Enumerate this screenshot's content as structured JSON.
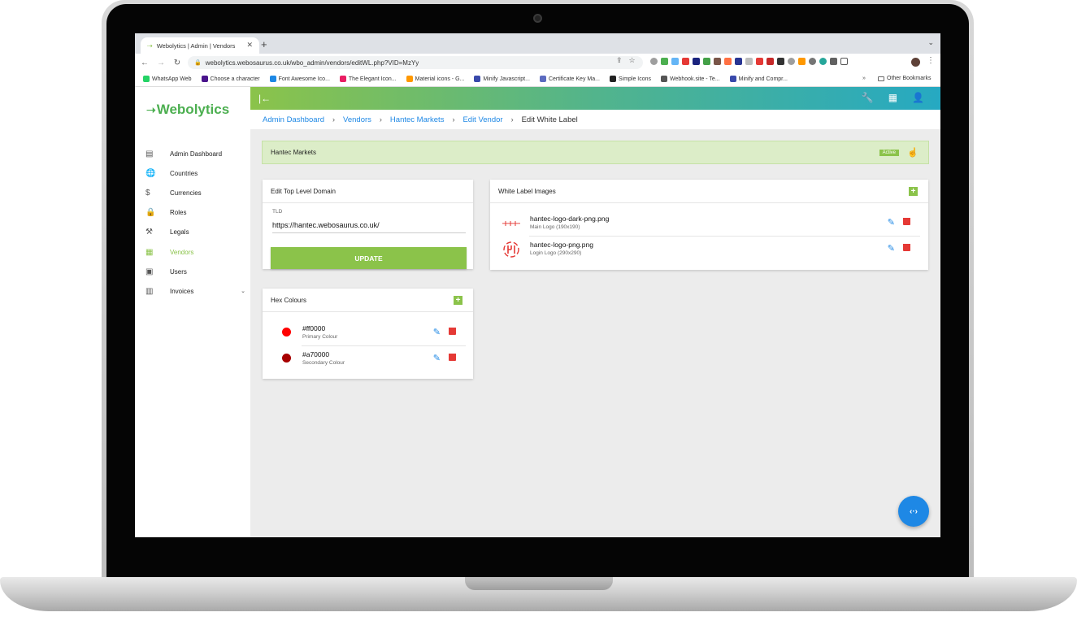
{
  "browser": {
    "tab_title": "Webolytics | Admin | Vendors",
    "url": "webolytics.webosaurus.co.uk/wbo_admin/vendors/editWL.php?VID=MzYy",
    "bookmarks": [
      {
        "label": "WhatsApp Web",
        "color": "#25d366"
      },
      {
        "label": "Choose a character",
        "color": "#4a148c"
      },
      {
        "label": "Font Awesome Ico...",
        "color": "#1e88e5"
      },
      {
        "label": "The Elegant Icon...",
        "color": "#e91e63"
      },
      {
        "label": "Material icons - G...",
        "color": "#ff9800"
      },
      {
        "label": "Minify Javascript...",
        "color": "#3949ab"
      },
      {
        "label": "Certificate Key Ma...",
        "color": "#5c6bc0"
      },
      {
        "label": "Simple Icons",
        "color": "#222222"
      },
      {
        "label": "Webhook.site - Te...",
        "color": "#555555"
      },
      {
        "label": "Minify and Compr...",
        "color": "#3949ab"
      }
    ],
    "bookmarks_more": "»",
    "other_bookmarks": "Other Bookmarks"
  },
  "app": {
    "logo_text": "Webolytics",
    "brand_color": "#8bc34a",
    "accent_color": "#1e88e5",
    "sidebar": {
      "items": [
        {
          "label": "Admin Dashboard",
          "icon": "dashboard-icon"
        },
        {
          "label": "Countries",
          "icon": "globe-icon"
        },
        {
          "label": "Currencies",
          "icon": "dollar-icon"
        },
        {
          "label": "Roles",
          "icon": "lock-icon"
        },
        {
          "label": "Legals",
          "icon": "gavel-icon"
        },
        {
          "label": "Vendors",
          "icon": "store-icon",
          "active": true
        },
        {
          "label": "Users",
          "icon": "users-icon"
        },
        {
          "label": "Invoices",
          "icon": "wallet-icon",
          "has_children": true
        }
      ]
    },
    "breadcrumb": {
      "items": [
        "Admin Dashboard",
        "Vendors",
        "Hantec Markets",
        "Edit Vendor"
      ],
      "current": "Edit White Label"
    },
    "vendor": {
      "name": "Hantec Markets",
      "status": "Active"
    },
    "tld_card": {
      "title": "Edit Top Level Domain",
      "field_label": "TLD",
      "value": "https://hantec.webosaurus.co.uk/",
      "button": "UPDATE"
    },
    "hex_card": {
      "title": "Hex Colours",
      "rows": [
        {
          "hex": "#ff0000",
          "label": "Primary Colour",
          "swatch": "#ff0000"
        },
        {
          "hex": "#a70000",
          "label": "Secondary Colour",
          "swatch": "#a70000"
        }
      ]
    },
    "images_card": {
      "title": "White Label Images",
      "rows": [
        {
          "file": "hantec-logo-dark-png.png",
          "label": "Main Logo (190x190)"
        },
        {
          "file": "hantec-logo-png.png",
          "label": "Login Logo (290x290)"
        }
      ]
    }
  }
}
